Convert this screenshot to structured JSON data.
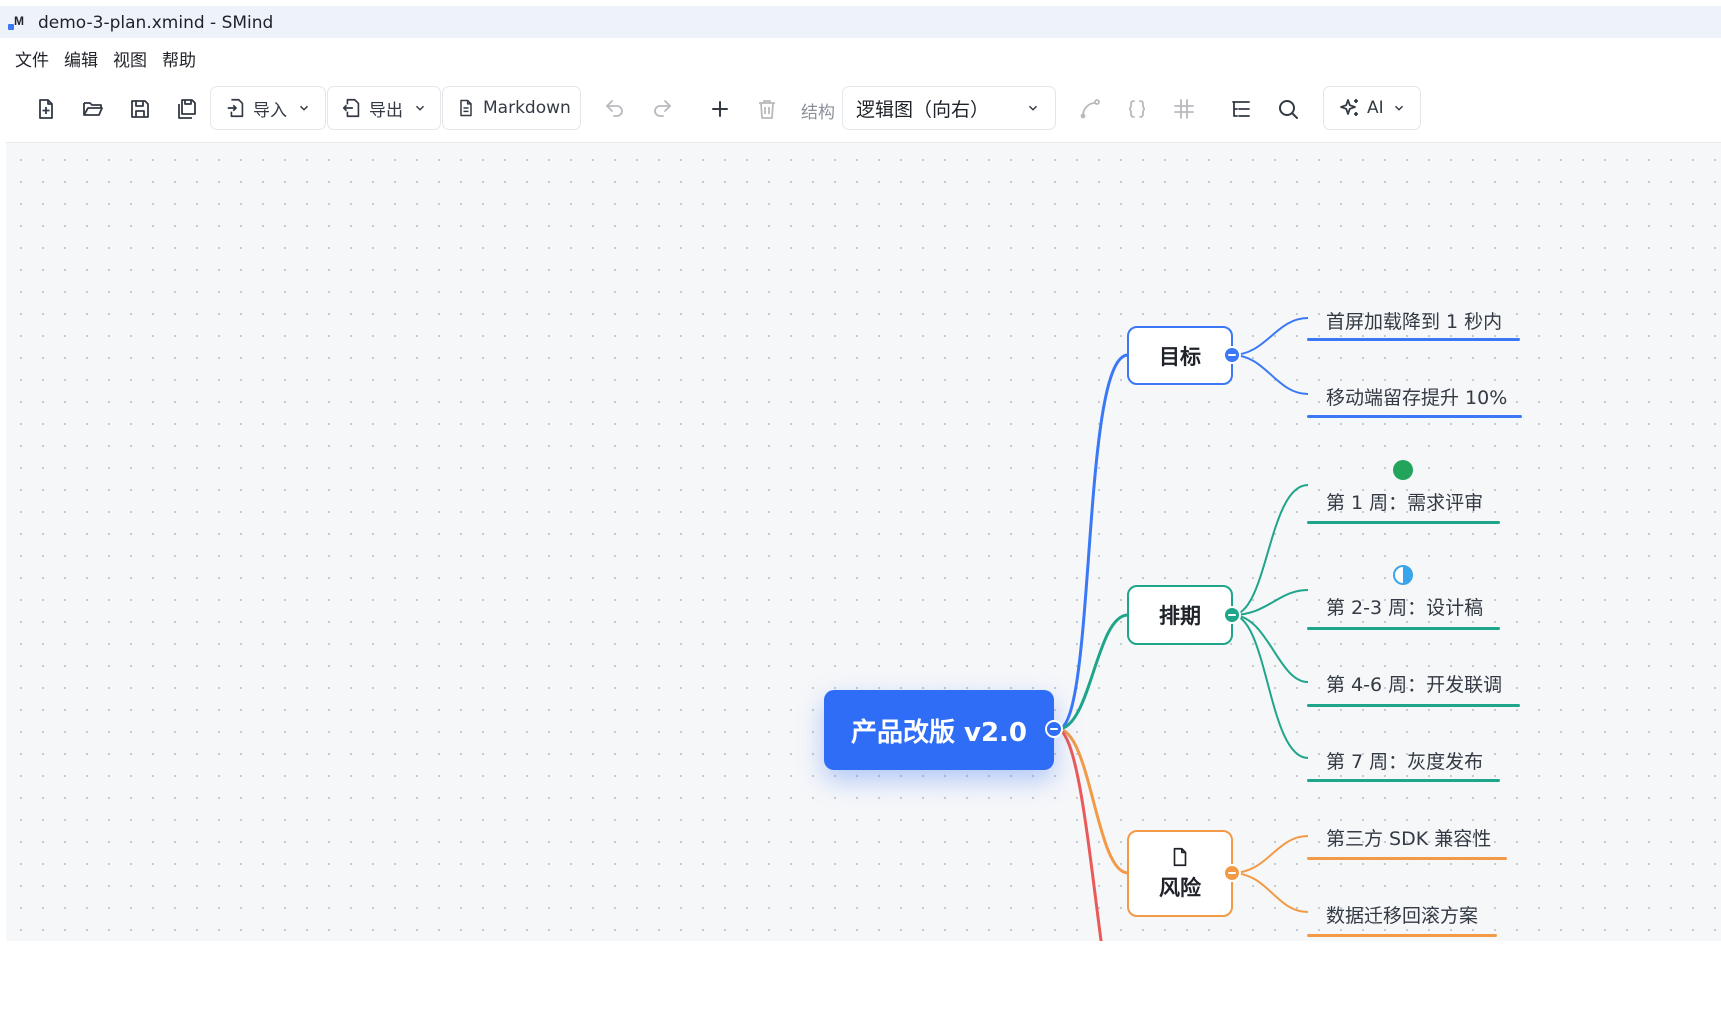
{
  "window": {
    "title": "demo-3-plan.xmind - SMind",
    "icon_letter": "M"
  },
  "menu": [
    "文件",
    "编辑",
    "视图",
    "帮助"
  ],
  "toolbar": {
    "import_label": "导入",
    "export_label": "导出",
    "markdown_label": "Markdown",
    "structure_label": "结构",
    "structure_value": "逻辑图（向右）",
    "ai_label": "AI"
  },
  "mindmap": {
    "root": "产品改版 v2.0",
    "branches": [
      {
        "label": "目标",
        "color": "#3b78f5",
        "children": [
          "首屏加载降到 1 秒内",
          "移动端留存提升 10%"
        ]
      },
      {
        "label": "排期",
        "color": "#1fa58a",
        "children": [
          "第 1 周：需求评审",
          "第 2-3 周：设计稿",
          "第 4-6 周：开发联调",
          "第 7 周：灰度发布"
        ],
        "markers": {
          "第 1 周：需求评审": "task-done",
          "第 2-3 周：设计稿": "task-half"
        }
      },
      {
        "label": "风险",
        "color": "#f39a47",
        "note_icon": "note-icon",
        "children": [
          "第三方 SDK 兼容性",
          "数据迁移回滚方案"
        ]
      },
      {
        "label": "",
        "color": "#ea5a5a",
        "children": []
      }
    ]
  }
}
